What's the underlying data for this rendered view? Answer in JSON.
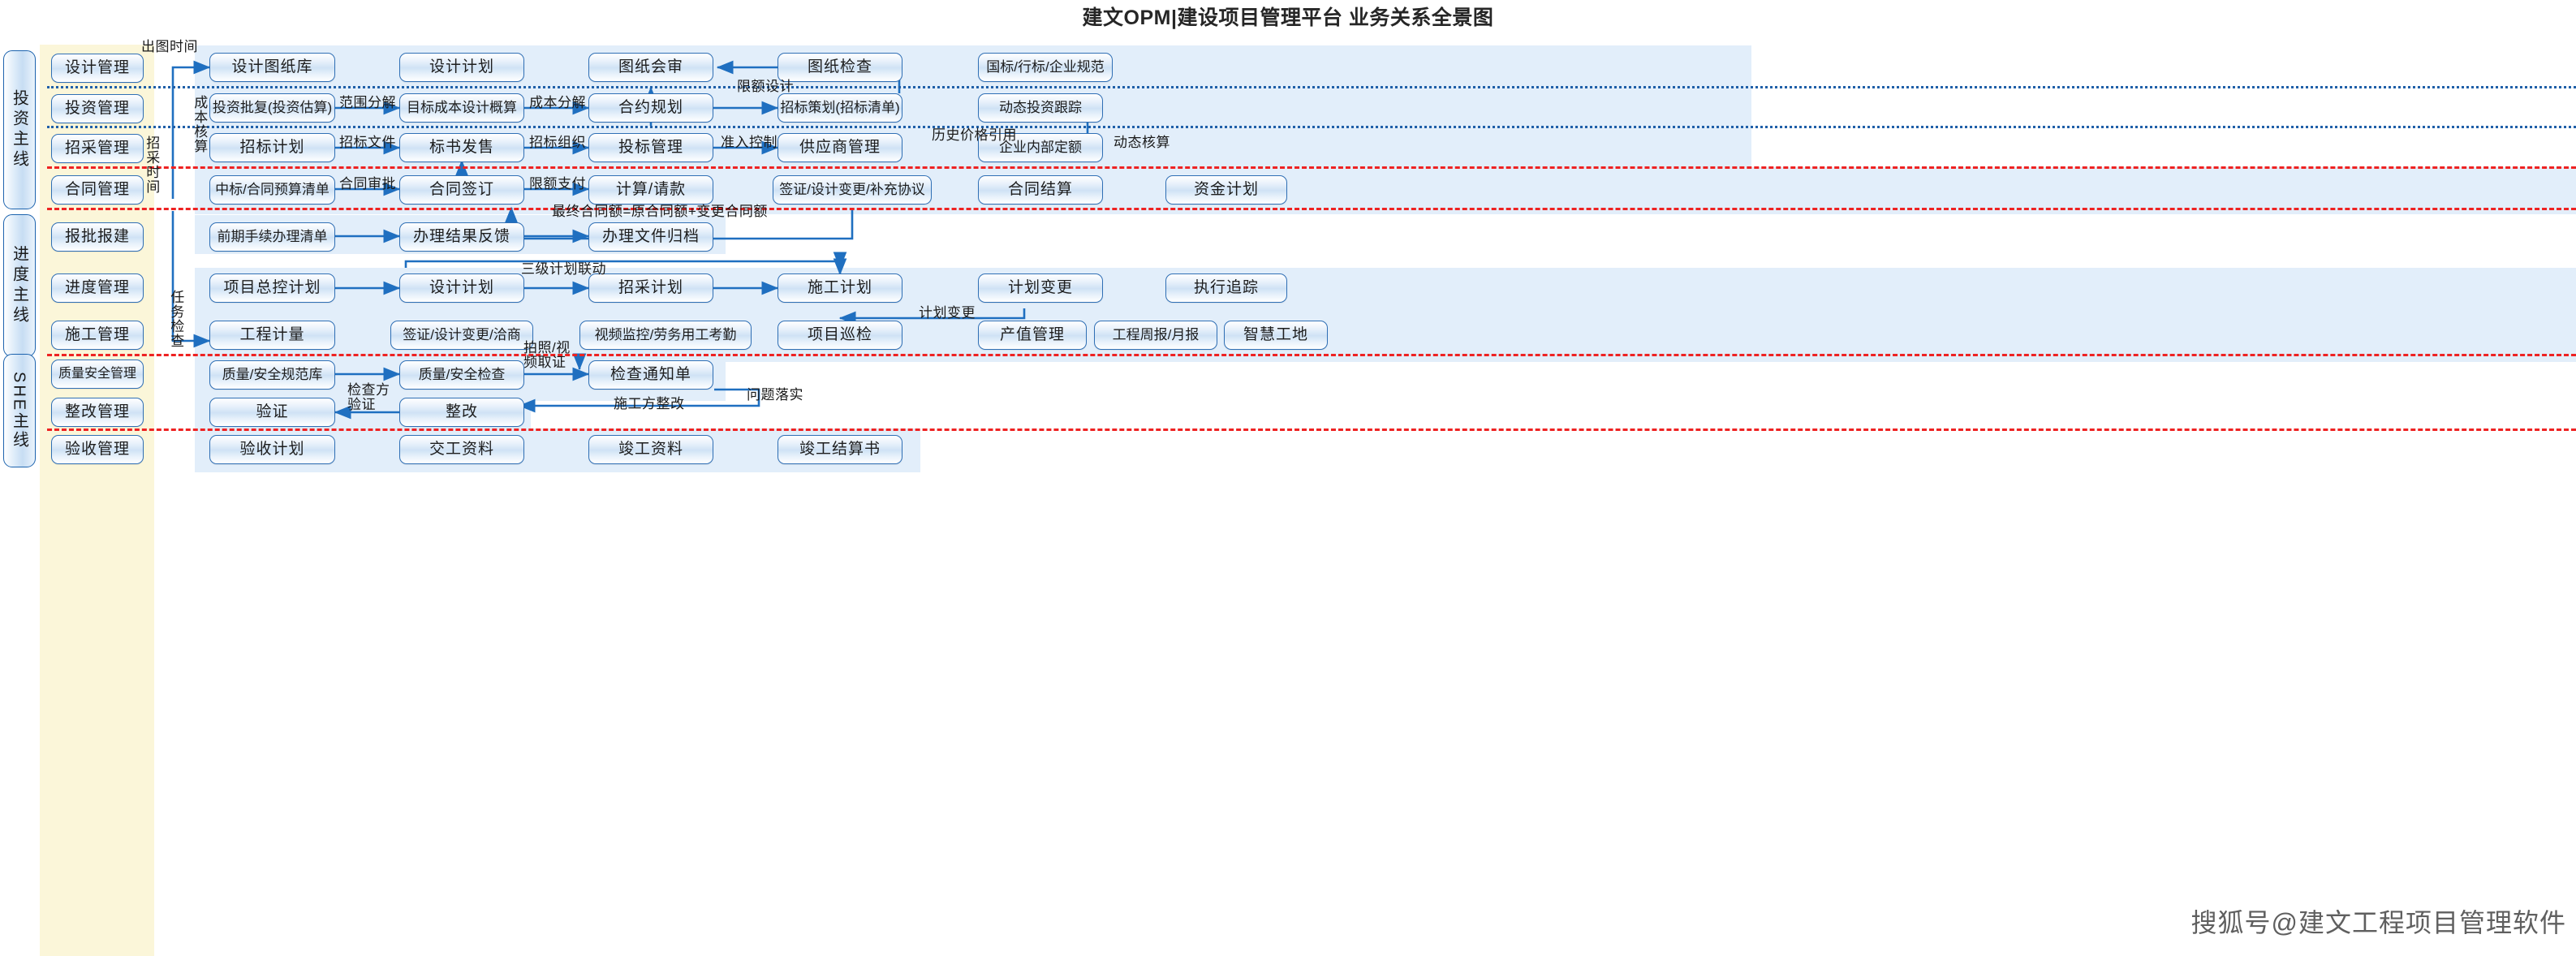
{
  "title": "建文OPM|建设项目管理平台 业务关系全景图",
  "watermark": "搜狐号@建文工程项目管理软件",
  "colors": {
    "node_border": "#2f6fb5",
    "band_bg": "#e2eefa",
    "module_column_bg": "#fbf6d9",
    "separator_red": "#ee2222",
    "connector_blue": "#1f6fc0",
    "spine_border": "#1c63ae"
  },
  "spines": [
    {
      "label": "投资主线"
    },
    {
      "label": "进度主线"
    },
    {
      "label": "SHE主线"
    }
  ],
  "modules": [
    {
      "label": "设计管理"
    },
    {
      "label": "投资管理"
    },
    {
      "label": "招采管理"
    },
    {
      "label": "合同管理"
    },
    {
      "label": "报批报建"
    },
    {
      "label": "进度管理"
    },
    {
      "label": "施工管理"
    },
    {
      "label": "质量安全管理"
    },
    {
      "label": "整改管理"
    },
    {
      "label": "验收管理"
    }
  ],
  "rows": [
    {
      "module": "设计管理",
      "nodes": [
        "设计图纸库",
        "设计计划",
        "图纸会审",
        "图纸检查",
        "国标/行标/企业规范"
      ]
    },
    {
      "module": "投资管理",
      "nodes": [
        "投资批复(投资估算)",
        "目标成本设计概算",
        "合约规划",
        "招标策划(招标清单)",
        "动态投资跟踪"
      ]
    },
    {
      "module": "招采管理",
      "nodes": [
        "招标计划",
        "标书发售",
        "投标管理",
        "供应商管理",
        "企业内部定额"
      ]
    },
    {
      "module": "合同管理",
      "nodes": [
        "中标/合同预算清单",
        "合同签订",
        "计算/请款",
        "签证/设计变更/补充协议",
        "合同结算",
        "资金计划"
      ]
    },
    {
      "module": "报批报建",
      "nodes": [
        "前期手续办理清单",
        "办理结果反馈",
        "办理文件归档"
      ]
    },
    {
      "module": "进度管理",
      "nodes": [
        "项目总控计划",
        "设计计划",
        "招采计划",
        "施工计划",
        "计划变更",
        "执行追踪"
      ]
    },
    {
      "module": "施工管理",
      "nodes": [
        "工程计量",
        "签证/设计变更/洽商",
        "视频监控/劳务用工考勤",
        "项目巡检",
        "产值管理",
        "工程周报/月报",
        "智慧工地"
      ]
    },
    {
      "module": "质量安全管理",
      "nodes": [
        "质量/安全规范库",
        "质量/安全检查",
        "检查通知单"
      ]
    },
    {
      "module": "整改管理",
      "nodes": [
        "验证",
        "整改"
      ]
    },
    {
      "module": "验收管理",
      "nodes": [
        "验收计划",
        "交工资料",
        "竣工资料",
        "竣工结算书"
      ]
    }
  ],
  "edge_labels": [
    "出图时间",
    "成本核算",
    "招采时间",
    "范围分解",
    "成本分解",
    "限额设计",
    "招标文件",
    "招标组织",
    "准入控制",
    "历史价格引用",
    "动态核算",
    "合同审批",
    "限额支付",
    "最终合同额=原合同额+变更合同额",
    "三级计划联动",
    "任务检查",
    "计划变更",
    "拍照/视频取证",
    "检查方验证",
    "施工方整改",
    "问题落实"
  ]
}
